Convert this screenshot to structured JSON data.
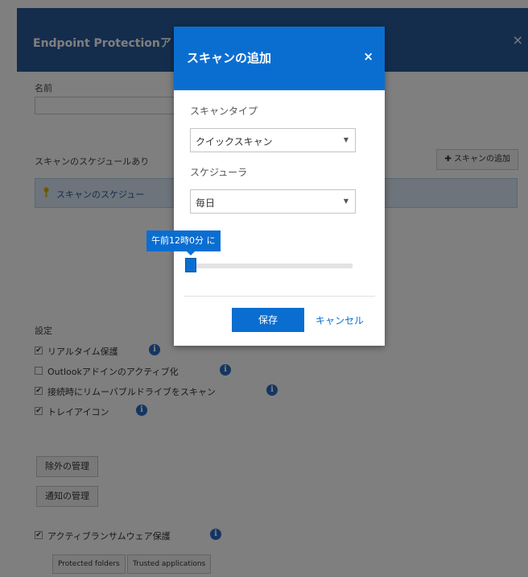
{
  "background_dialog": {
    "title": "Endpoint Protectionア",
    "close_icon": "×",
    "name_label": "名前",
    "name_value": "",
    "schedule_label": "スキャンのスケジュールあり",
    "add_scan_button": "✚ スキャンの追加",
    "schedule_info": "スキャンのスケジュー",
    "settings_label": "設定",
    "settings": [
      {
        "label": "リアルタイム保護",
        "checked": true,
        "info": true
      },
      {
        "label": "Outlookアドインのアクティブ化",
        "checked": false,
        "info": true
      },
      {
        "label": "接続時にリムーバブルドライブをスキャン",
        "checked": true,
        "info": true
      },
      {
        "label": "トレイアイコン",
        "checked": true,
        "info": true
      }
    ],
    "exclusions_button": "除外の管理",
    "notifications_button": "通知の管理",
    "ransomware_label": "アクティブランサムウェア保護",
    "ransomware_checked": true,
    "protected_folders_button": "Protected folders",
    "trusted_apps_button": "Trusted applications",
    "check_mark": "✔",
    "info_glyph": "i"
  },
  "modal": {
    "title": "スキャンの追加",
    "close_icon": "×",
    "scan_type_label": "スキャンタイプ",
    "scan_type_value": "クイックスキャン",
    "scheduler_label": "スケジューラ",
    "scheduler_value": "毎日",
    "time_tooltip": "午前12時0分 に",
    "time_slider_fraction": 0.0,
    "save_button": "保存",
    "cancel_link": "キャンセル",
    "caret_glyph": "▼"
  },
  "colors": {
    "modal_header": "#0a6ed1",
    "bg_header": "#2b5a9a",
    "overlay": "rgba(0,0,0,0.5)"
  }
}
